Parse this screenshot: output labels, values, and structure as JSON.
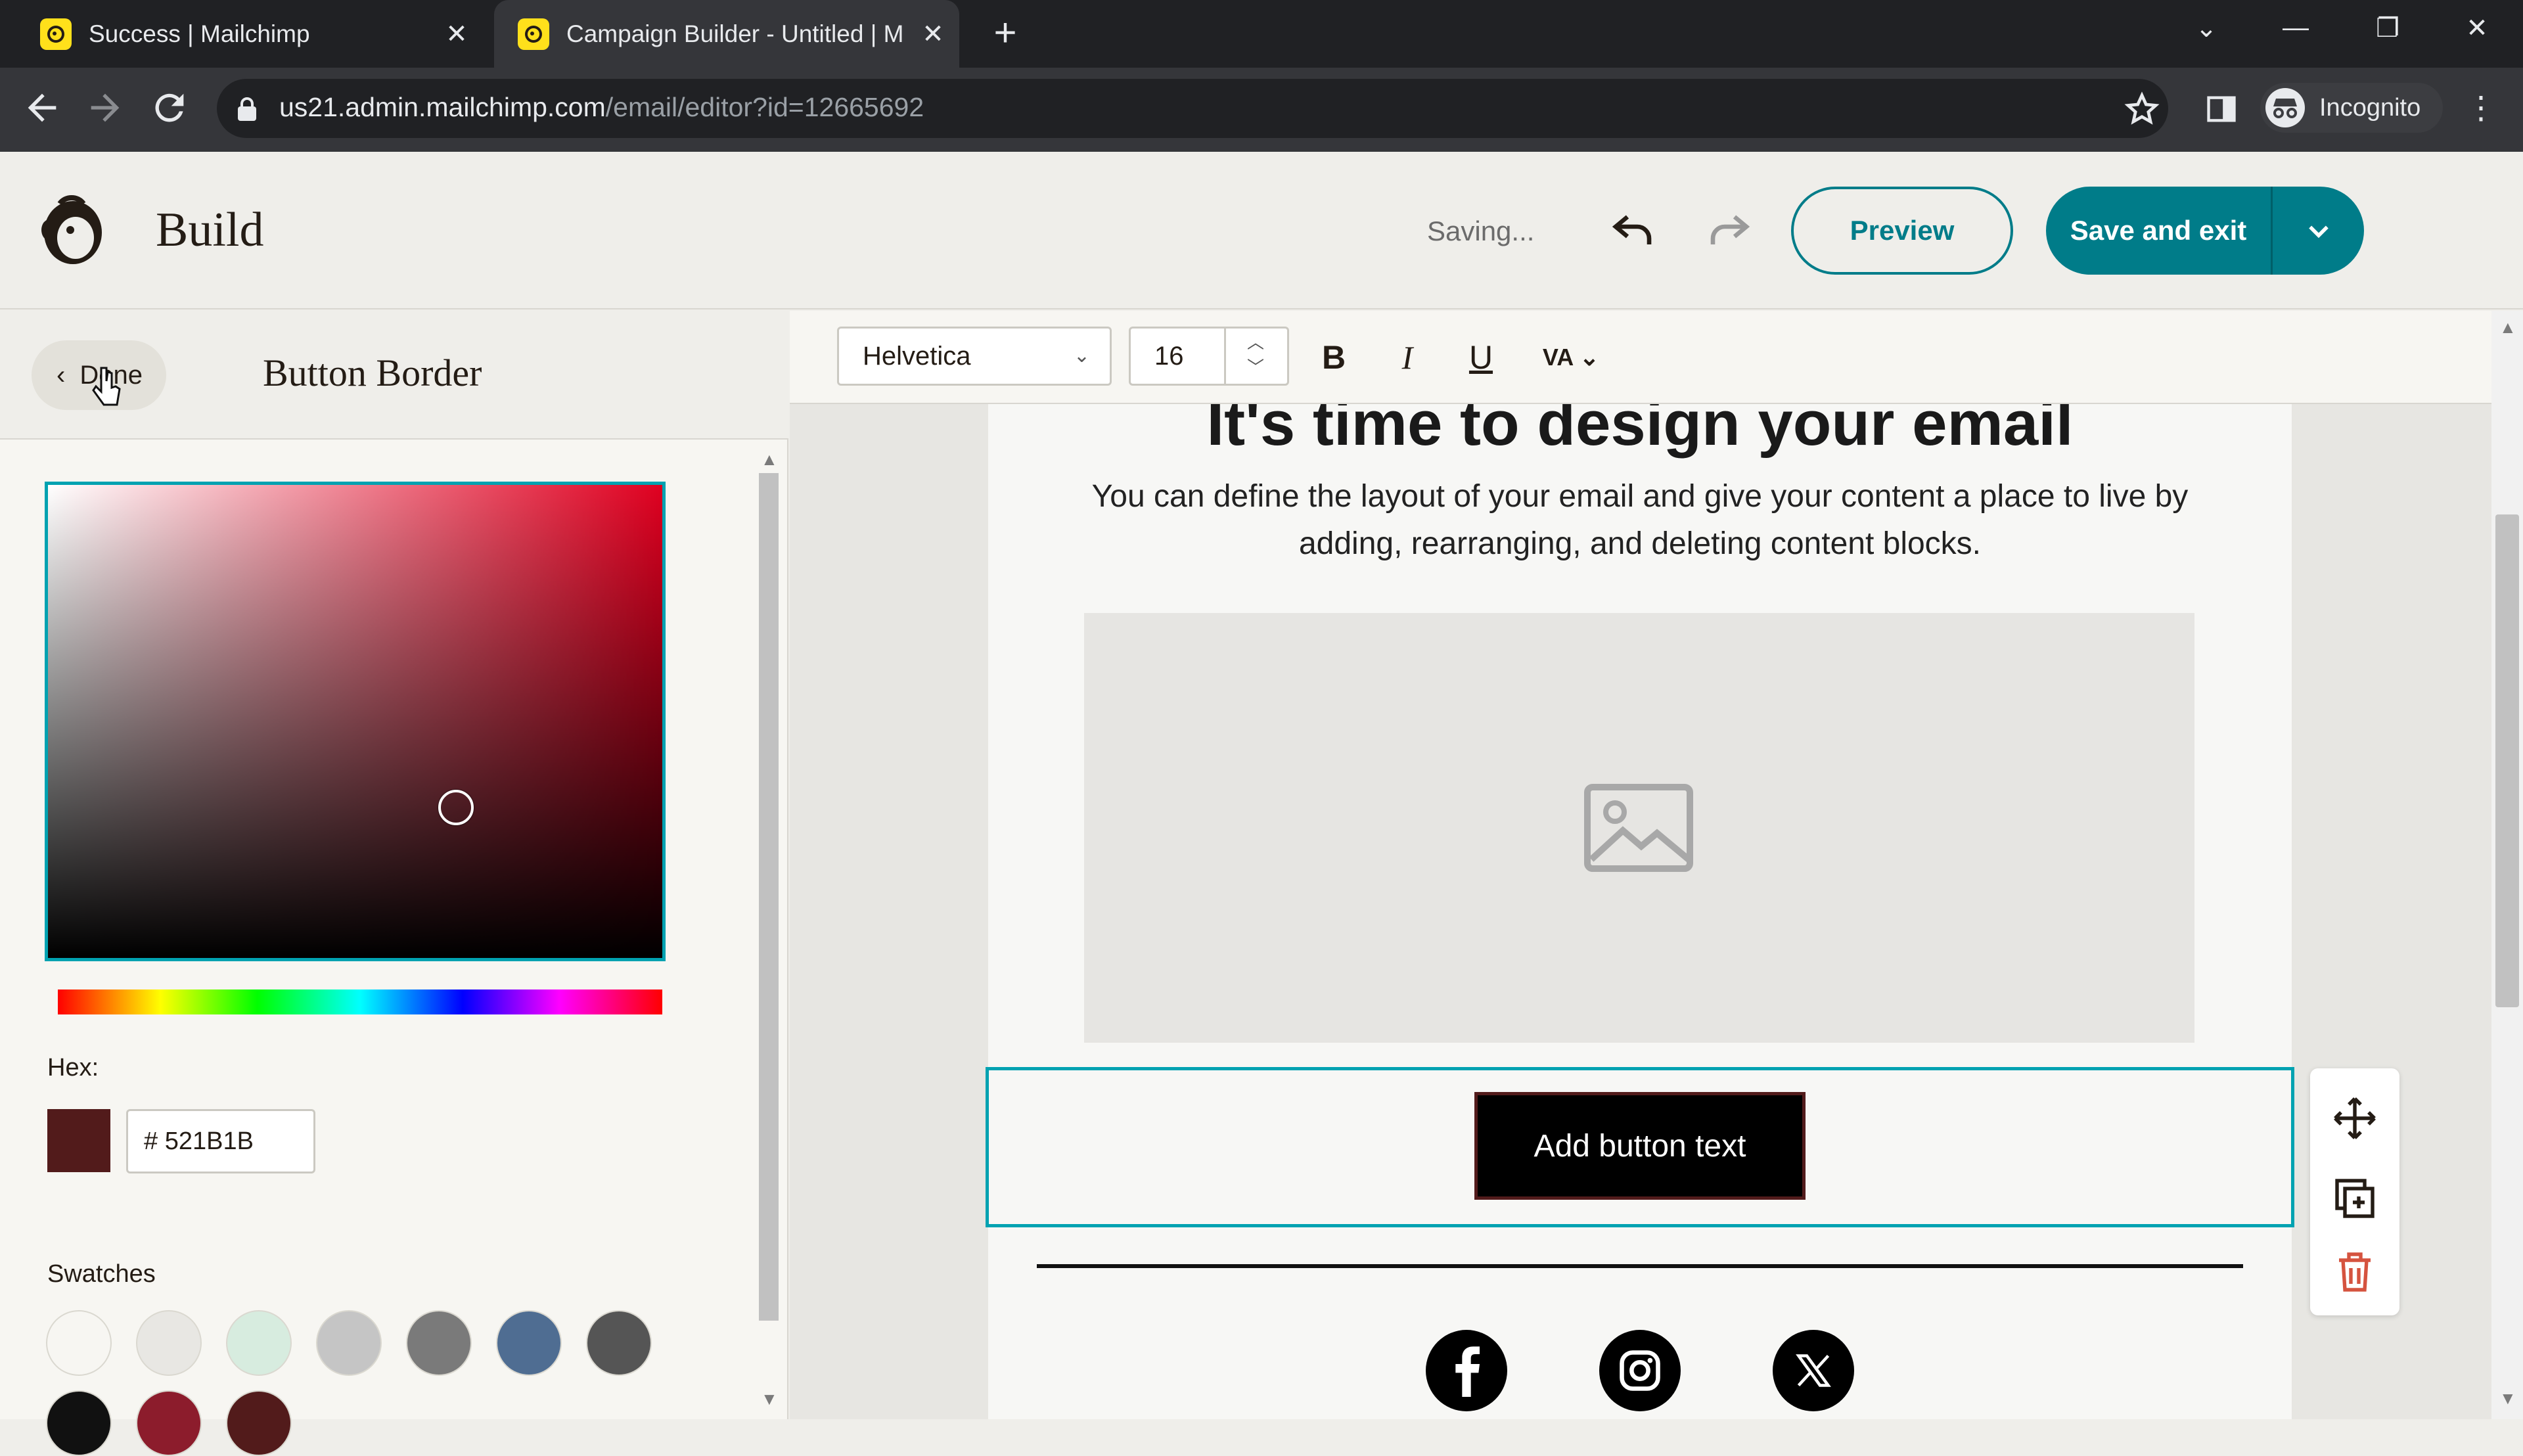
{
  "browser": {
    "tabs": [
      {
        "title": "Success | Mailchimp",
        "close": "✕"
      },
      {
        "title": "Campaign Builder - Untitled | M",
        "close": "✕"
      }
    ],
    "new_tab": "+",
    "window_controls": {
      "minimize": "—",
      "restore": "❐",
      "close": "✕",
      "tab_search": "⌄"
    },
    "url_host": "us21.admin.mailchimp.com",
    "url_path": "/email/editor?id=12665692",
    "profile": "Incognito"
  },
  "header": {
    "title": "Build",
    "status": "Saving...",
    "preview_label": "Preview",
    "save_label": "Save and exit"
  },
  "panel": {
    "done_label": "Done",
    "title": "Button Border",
    "hex_label": "Hex:",
    "hex_value": "# 521B1B",
    "swatches_label": "Swatches",
    "current_color": "#521b1b",
    "swatches": [
      "#f7f6f2",
      "#e8e7e3",
      "#d7ecdf",
      "#c5c5c5",
      "#7a7a7a",
      "#4f6d92",
      "#555555",
      "#111111",
      "#8c1c2c",
      "#521b1b"
    ]
  },
  "toolbar": {
    "font": "Helvetica",
    "size": "16",
    "bold": "B",
    "italic": "I",
    "underline": "U",
    "spacing": "VA"
  },
  "email": {
    "headline": "It's time to design your email",
    "body": "You can define the layout of your email and give your content a place to live by adding, rearranging, and deleting content blocks.",
    "button_text": "Add button text",
    "social": [
      "facebook-icon",
      "instagram-icon",
      "x-icon"
    ]
  }
}
